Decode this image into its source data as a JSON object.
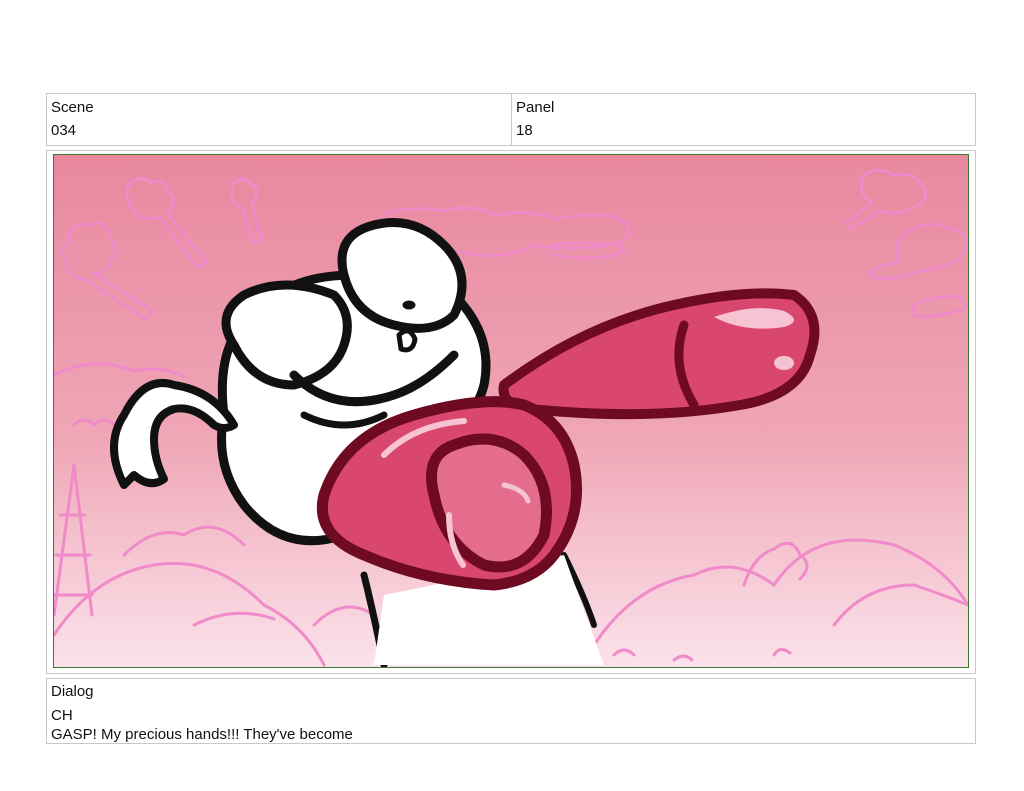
{
  "header": {
    "scene_label": "Scene",
    "scene_value": "034",
    "panel_label": "Panel",
    "panel_value": "18"
  },
  "panel_image": {
    "background_top_color": "#e8889f",
    "background_bottom_color": "#fbe2ea",
    "doodle_color": "#f08ac8",
    "glove_color": "#d9476f",
    "glove_dark_color": "#6e0a22",
    "ink_color": "#111111"
  },
  "dialog": {
    "label": "Dialog",
    "speaker": "CH",
    "line": "GASP! My precious hands!!! They've become"
  }
}
